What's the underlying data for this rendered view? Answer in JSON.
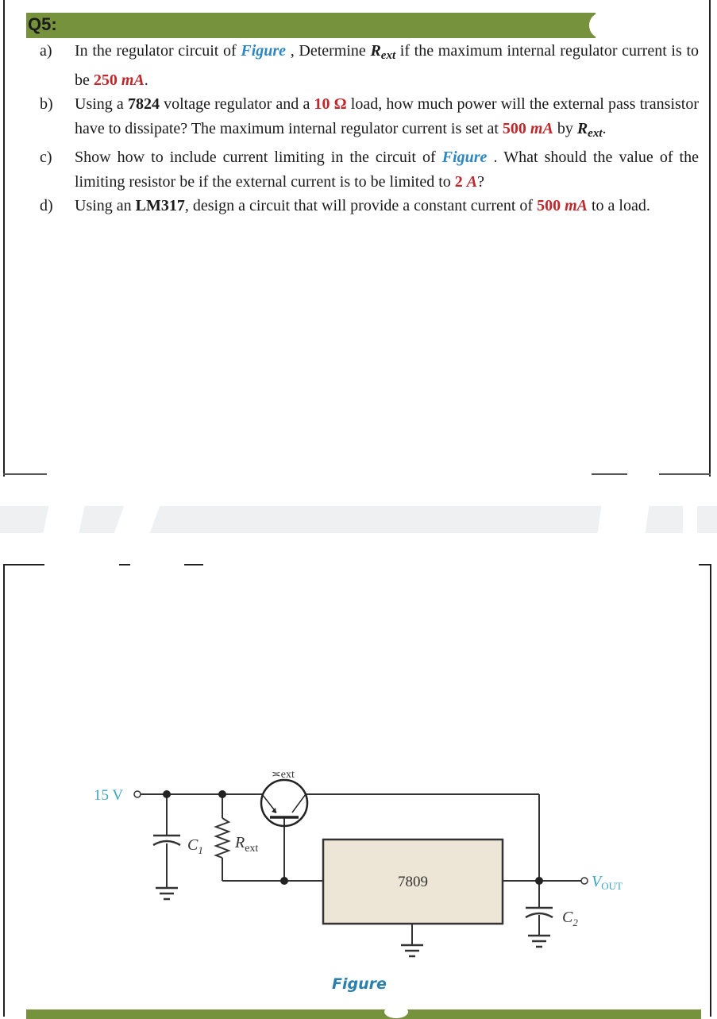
{
  "question": {
    "title": "Q5:",
    "header_color": "#76923c",
    "items": [
      {
        "letter": "a)",
        "parts": [
          "In the regulator circuit of ",
          "Figure",
          " , Determine ",
          "R",
          "ext",
          " if the maximum internal regulator current is to be ",
          "250 ",
          "mA",
          "."
        ]
      },
      {
        "letter": "b)",
        "parts": [
          "Using a ",
          "7824",
          " voltage regulator and a ",
          "10 Ω",
          " load, how much power will the external pass transistor have to dissipate? The maximum internal regulator current is set at ",
          "500 ",
          "mA",
          " by ",
          "R",
          "ext",
          "."
        ]
      },
      {
        "letter": "c)",
        "parts": [
          "Show how to include current limiting in the circuit of ",
          "Figure",
          " . What should the value of the limiting resistor be if the external current is to be limited to ",
          "2 ",
          "A",
          "?"
        ]
      },
      {
        "letter": "d)",
        "parts": [
          "Using an ",
          "LM317",
          ", design a circuit that will provide a constant current of ",
          "500 ",
          "mA",
          " to a load."
        ]
      }
    ]
  },
  "figure": {
    "caption": "Figure",
    "labels": {
      "input_voltage": "15 V",
      "transistor": "ext",
      "resistor": "R",
      "resistor_sub": "ext",
      "cap1": "C",
      "cap1_sub": "1",
      "regulator": "7809",
      "cap2": "C",
      "cap2_sub": "2",
      "output": "V",
      "output_sub": "OUT"
    },
    "colors": {
      "label_blue": "#3aa6c4",
      "regulator_fill": "#ede6d6",
      "wire": "#333333"
    }
  }
}
